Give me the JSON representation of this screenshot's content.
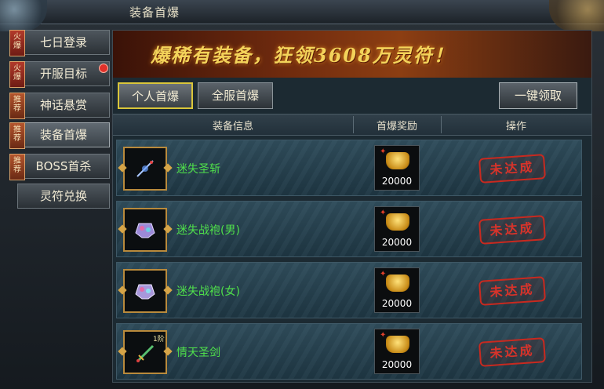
{
  "window": {
    "title": "装备首爆"
  },
  "sidebar": {
    "items": [
      {
        "label": "七日登录",
        "tag": "火爆",
        "badge": false
      },
      {
        "label": "开服目标",
        "tag": "火爆",
        "badge": true
      },
      {
        "label": "神话悬赏",
        "tag": "推荐",
        "badge": false
      },
      {
        "label": "装备首爆",
        "tag": "推荐",
        "badge": false,
        "active": true
      },
      {
        "label": "BOSS首杀",
        "tag": "推荐",
        "badge": false
      },
      {
        "label": "灵符兑换",
        "tag": "",
        "badge": false
      }
    ]
  },
  "banner": {
    "text": "爆稀有装备，狂领3608万灵符！"
  },
  "tabs": [
    {
      "label": "个人首爆",
      "selected": true
    },
    {
      "label": "全服首爆",
      "selected": false
    }
  ],
  "claim_all_label": "一键领取",
  "table": {
    "columns": [
      "装备信息",
      "首爆奖励",
      "操作"
    ],
    "rows": [
      {
        "name": "迷失圣斩",
        "reward": "20000",
        "status": "未达成",
        "level": ""
      },
      {
        "name": "迷失战袍(男)",
        "reward": "20000",
        "status": "未达成",
        "level": ""
      },
      {
        "name": "迷失战袍(女)",
        "reward": "20000",
        "status": "未达成",
        "level": ""
      },
      {
        "name": "情天圣剑",
        "reward": "20000",
        "status": "未达成",
        "level": "1阶"
      }
    ]
  },
  "colors": {
    "item_name": "#4fe04a",
    "stamp": "#c9291f",
    "highlight": "#d9c63a"
  }
}
